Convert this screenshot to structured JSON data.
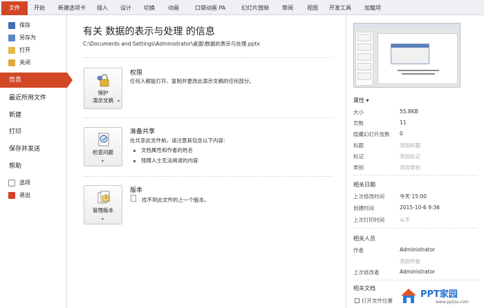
{
  "ribbon": {
    "tabs": [
      "文件",
      "开始",
      "新建选项卡",
      "插入",
      "设计",
      "切换",
      "动画",
      "口袋动画 PA",
      "幻灯片放映",
      "审阅",
      "视图",
      "开发工具",
      "加载项"
    ]
  },
  "nav": {
    "small_top": [
      {
        "label": "保存",
        "icon": "save-icon"
      },
      {
        "label": "另存为",
        "icon": "save-as-icon"
      },
      {
        "label": "打开",
        "icon": "open-folder-icon"
      },
      {
        "label": "关闭",
        "icon": "close-folder-icon"
      }
    ],
    "big": [
      "信息",
      "最近所用文件",
      "新建",
      "打印",
      "保存并发送",
      "帮助"
    ],
    "small_bottom": [
      {
        "label": "选项",
        "icon": "options-icon"
      },
      {
        "label": "退出",
        "icon": "exit-icon"
      }
    ]
  },
  "info": {
    "title": "有关 数据的表示与处理 的信息",
    "path": "C:\\Documents and Settings\\Administrator\\桌面\\数据的表示与处理.pptx"
  },
  "sections": {
    "permissions": {
      "button": [
        "保护",
        "演示文稿"
      ],
      "heading": "权限",
      "text": "任何人都能打开、复制并更改此演示文稿的任何部分。"
    },
    "prepare": {
      "button": "检查问题",
      "heading": "准备共享",
      "text": "在共享此文件前，请注意其包含以下内容:",
      "bullets": [
        "文档属性和作者的姓名",
        "残障人士无法阅读的内容"
      ]
    },
    "versions": {
      "button": "管理版本",
      "heading": "版本",
      "text": "找不到此文件的上一个版本。"
    }
  },
  "properties": {
    "heading": "属性",
    "rows": [
      {
        "label": "大小",
        "value": "55.8KB"
      },
      {
        "label": "页数",
        "value": "11"
      },
      {
        "label": "隐藏幻灯片张数",
        "value": "0"
      },
      {
        "label": "标题",
        "value": "添加标题"
      },
      {
        "label": "标记",
        "value": "添加标记"
      },
      {
        "label": "类别",
        "value": "添加类别"
      }
    ]
  },
  "dates": {
    "heading": "相关日期",
    "rows": [
      {
        "label": "上次修改时间",
        "value": "今天 15:00"
      },
      {
        "label": "创建时间",
        "value": "2015-10-6 9:36"
      },
      {
        "label": "上次打印时间",
        "value": "从不"
      }
    ]
  },
  "people": {
    "heading": "相关人员",
    "author_label": "作者",
    "author_value": "Administrator",
    "add_author": "添加作者",
    "modified_label": "上次修改者",
    "modified_value": "Administrator"
  },
  "documents": {
    "heading": "相关文档",
    "open_location": "打开文件位置"
  },
  "watermark": {
    "name": "PPT家园",
    "url": "www.pptjia.com"
  },
  "colors": {
    "accent": "#d24726",
    "watermark": "#1f6fd0"
  }
}
